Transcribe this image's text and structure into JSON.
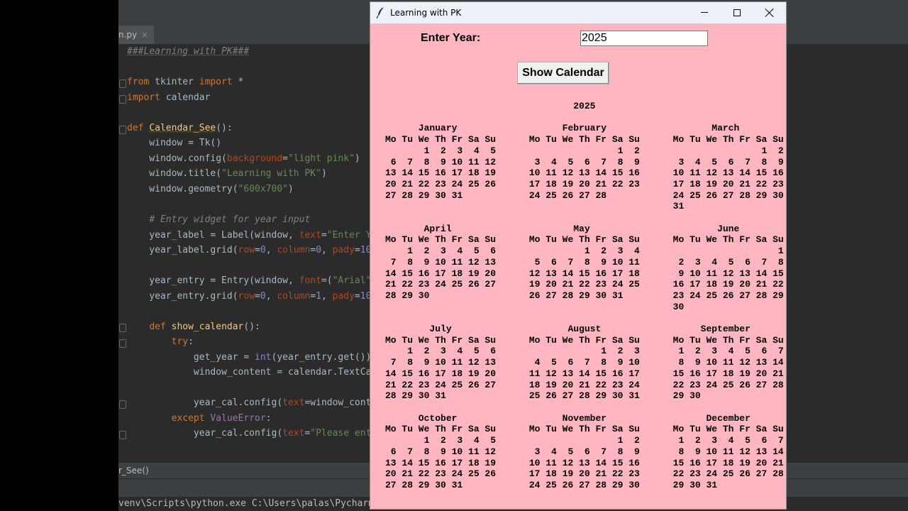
{
  "ide": {
    "tab_label": "n.py",
    "tab_close": "×",
    "code_lines": [
      "###Learning with PK###",
      "",
      "from tkinter import *",
      "import calendar",
      "",
      "def Calendar_See():",
      "    window = Tk()",
      "    window.config(background=\"light pink\")",
      "    window.title(\"Learning with PK\")",
      "    window.geometry(\"600x700\")",
      "",
      "    # Entry widget for year input",
      "    year_label = Label(window, text=\"Enter Y",
      "    year_label.grid(row=0, column=0, pady=10",
      "",
      "    year_entry = Entry(window, font=(\"Arial\"",
      "    year_entry.grid(row=0, column=1, pady=10",
      "",
      "    def show_calendar():",
      "        try:",
      "            get_year = int(year_entry.get())",
      "            window_content = calendar.TextCa",
      "",
      "            year_cal.config(text=window_cont",
      "        except ValueError:",
      "            year_cal.config(text=\"Please ent"
    ],
    "breadcrumb": "r_See()",
    "terminal_line": "venv\\Scripts\\python.exe C:\\Users\\palas\\Pycharm"
  },
  "window": {
    "title": "Learning with PK",
    "minimize_icon": "minimize-icon",
    "maximize_icon": "maximize-icon",
    "close_icon": "close-icon",
    "background": "#ffb6c1"
  },
  "form": {
    "year_label": "Enter Year:",
    "year_value": "2025",
    "show_button_label": "Show Calendar"
  },
  "calendar": {
    "text": "                                  2025\n\n      January                   February                   March\nMo Tu We Th Fr Sa Su      Mo Tu We Th Fr Sa Su      Mo Tu We Th Fr Sa Su\n       1  2  3  4  5                      1  2                      1  2\n 6  7  8  9 10 11 12       3  4  5  6  7  8  9       3  4  5  6  7  8  9\n13 14 15 16 17 18 19      10 11 12 13 14 15 16      10 11 12 13 14 15 16\n20 21 22 23 24 25 26      17 18 19 20 21 22 23      17 18 19 20 21 22 23\n27 28 29 30 31            24 25 26 27 28            24 25 26 27 28 29 30\n                                                    31\n\n       April                      May                       June\nMo Tu We Th Fr Sa Su      Mo Tu We Th Fr Sa Su      Mo Tu We Th Fr Sa Su\n    1  2  3  4  5  6                1  2  3  4                         1\n 7  8  9 10 11 12 13       5  6  7  8  9 10 11       2  3  4  5  6  7  8\n14 15 16 17 18 19 20      12 13 14 15 16 17 18       9 10 11 12 13 14 15\n21 22 23 24 25 26 27      19 20 21 22 23 24 25      16 17 18 19 20 21 22\n28 29 30                  26 27 28 29 30 31         23 24 25 26 27 28 29\n                                                    30\n\n        July                     August                  September\nMo Tu We Th Fr Sa Su      Mo Tu We Th Fr Sa Su      Mo Tu We Th Fr Sa Su\n    1  2  3  4  5  6                   1  2  3       1  2  3  4  5  6  7\n 7  8  9 10 11 12 13       4  5  6  7  8  9 10       8  9 10 11 12 13 14\n14 15 16 17 18 19 20      11 12 13 14 15 16 17      15 16 17 18 19 20 21\n21 22 23 24 25 26 27      18 19 20 21 22 23 24      22 23 24 25 26 27 28\n28 29 30 31               25 26 27 28 29 30 31      29 30\n\n      October                   November                  December\nMo Tu We Th Fr Sa Su      Mo Tu We Th Fr Sa Su      Mo Tu We Th Fr Sa Su\n       1  2  3  4  5                      1  2       1  2  3  4  5  6  7\n 6  7  8  9 10 11 12       3  4  5  6  7  8  9       8  9 10 11 12 13 14\n13 14 15 16 17 18 19      10 11 12 13 14 15 16      15 16 17 18 19 20 21\n20 21 22 23 24 25 26      17 18 19 20 21 22 23      22 23 24 25 26 27 28\n27 28 29 30 31            24 25 26 27 28 29 30      29 30 31"
  }
}
